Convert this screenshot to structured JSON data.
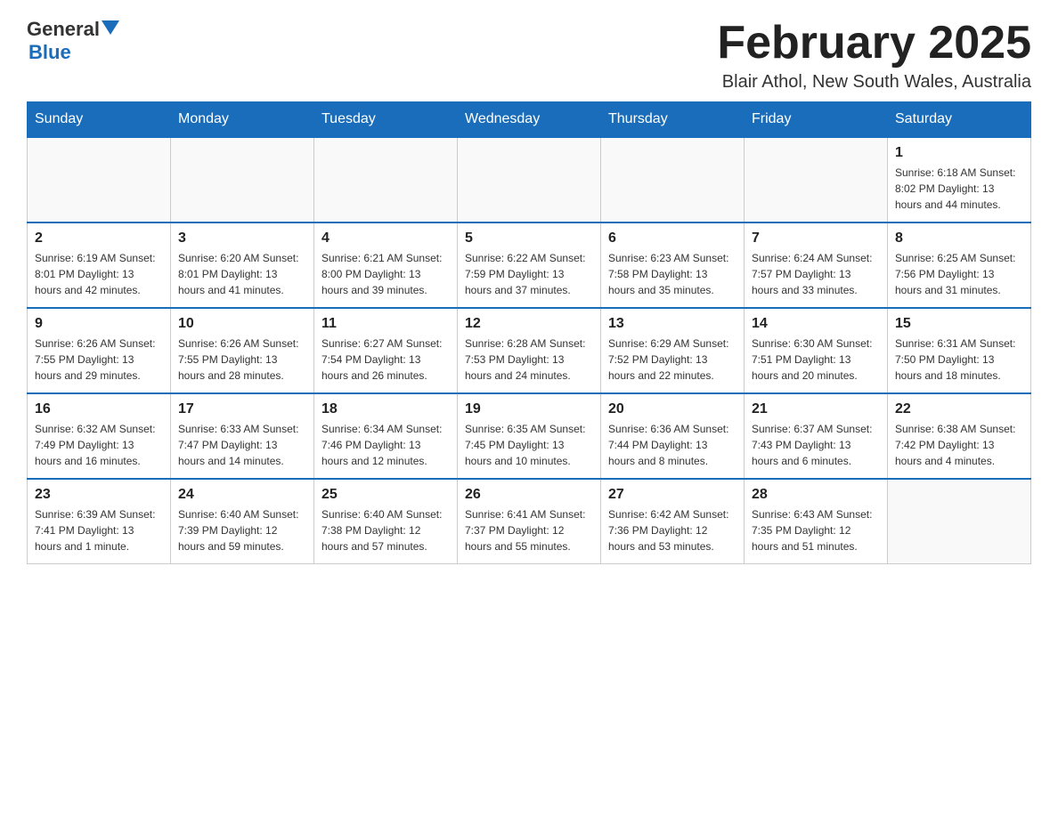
{
  "logo": {
    "general": "General",
    "blue": "Blue"
  },
  "title": "February 2025",
  "location": "Blair Athol, New South Wales, Australia",
  "days_of_week": [
    "Sunday",
    "Monday",
    "Tuesday",
    "Wednesday",
    "Thursday",
    "Friday",
    "Saturday"
  ],
  "weeks": [
    [
      {
        "day": "",
        "info": ""
      },
      {
        "day": "",
        "info": ""
      },
      {
        "day": "",
        "info": ""
      },
      {
        "day": "",
        "info": ""
      },
      {
        "day": "",
        "info": ""
      },
      {
        "day": "",
        "info": ""
      },
      {
        "day": "1",
        "info": "Sunrise: 6:18 AM\nSunset: 8:02 PM\nDaylight: 13 hours and 44 minutes."
      }
    ],
    [
      {
        "day": "2",
        "info": "Sunrise: 6:19 AM\nSunset: 8:01 PM\nDaylight: 13 hours and 42 minutes."
      },
      {
        "day": "3",
        "info": "Sunrise: 6:20 AM\nSunset: 8:01 PM\nDaylight: 13 hours and 41 minutes."
      },
      {
        "day": "4",
        "info": "Sunrise: 6:21 AM\nSunset: 8:00 PM\nDaylight: 13 hours and 39 minutes."
      },
      {
        "day": "5",
        "info": "Sunrise: 6:22 AM\nSunset: 7:59 PM\nDaylight: 13 hours and 37 minutes."
      },
      {
        "day": "6",
        "info": "Sunrise: 6:23 AM\nSunset: 7:58 PM\nDaylight: 13 hours and 35 minutes."
      },
      {
        "day": "7",
        "info": "Sunrise: 6:24 AM\nSunset: 7:57 PM\nDaylight: 13 hours and 33 minutes."
      },
      {
        "day": "8",
        "info": "Sunrise: 6:25 AM\nSunset: 7:56 PM\nDaylight: 13 hours and 31 minutes."
      }
    ],
    [
      {
        "day": "9",
        "info": "Sunrise: 6:26 AM\nSunset: 7:55 PM\nDaylight: 13 hours and 29 minutes."
      },
      {
        "day": "10",
        "info": "Sunrise: 6:26 AM\nSunset: 7:55 PM\nDaylight: 13 hours and 28 minutes."
      },
      {
        "day": "11",
        "info": "Sunrise: 6:27 AM\nSunset: 7:54 PM\nDaylight: 13 hours and 26 minutes."
      },
      {
        "day": "12",
        "info": "Sunrise: 6:28 AM\nSunset: 7:53 PM\nDaylight: 13 hours and 24 minutes."
      },
      {
        "day": "13",
        "info": "Sunrise: 6:29 AM\nSunset: 7:52 PM\nDaylight: 13 hours and 22 minutes."
      },
      {
        "day": "14",
        "info": "Sunrise: 6:30 AM\nSunset: 7:51 PM\nDaylight: 13 hours and 20 minutes."
      },
      {
        "day": "15",
        "info": "Sunrise: 6:31 AM\nSunset: 7:50 PM\nDaylight: 13 hours and 18 minutes."
      }
    ],
    [
      {
        "day": "16",
        "info": "Sunrise: 6:32 AM\nSunset: 7:49 PM\nDaylight: 13 hours and 16 minutes."
      },
      {
        "day": "17",
        "info": "Sunrise: 6:33 AM\nSunset: 7:47 PM\nDaylight: 13 hours and 14 minutes."
      },
      {
        "day": "18",
        "info": "Sunrise: 6:34 AM\nSunset: 7:46 PM\nDaylight: 13 hours and 12 minutes."
      },
      {
        "day": "19",
        "info": "Sunrise: 6:35 AM\nSunset: 7:45 PM\nDaylight: 13 hours and 10 minutes."
      },
      {
        "day": "20",
        "info": "Sunrise: 6:36 AM\nSunset: 7:44 PM\nDaylight: 13 hours and 8 minutes."
      },
      {
        "day": "21",
        "info": "Sunrise: 6:37 AM\nSunset: 7:43 PM\nDaylight: 13 hours and 6 minutes."
      },
      {
        "day": "22",
        "info": "Sunrise: 6:38 AM\nSunset: 7:42 PM\nDaylight: 13 hours and 4 minutes."
      }
    ],
    [
      {
        "day": "23",
        "info": "Sunrise: 6:39 AM\nSunset: 7:41 PM\nDaylight: 13 hours and 1 minute."
      },
      {
        "day": "24",
        "info": "Sunrise: 6:40 AM\nSunset: 7:39 PM\nDaylight: 12 hours and 59 minutes."
      },
      {
        "day": "25",
        "info": "Sunrise: 6:40 AM\nSunset: 7:38 PM\nDaylight: 12 hours and 57 minutes."
      },
      {
        "day": "26",
        "info": "Sunrise: 6:41 AM\nSunset: 7:37 PM\nDaylight: 12 hours and 55 minutes."
      },
      {
        "day": "27",
        "info": "Sunrise: 6:42 AM\nSunset: 7:36 PM\nDaylight: 12 hours and 53 minutes."
      },
      {
        "day": "28",
        "info": "Sunrise: 6:43 AM\nSunset: 7:35 PM\nDaylight: 12 hours and 51 minutes."
      },
      {
        "day": "",
        "info": ""
      }
    ]
  ]
}
